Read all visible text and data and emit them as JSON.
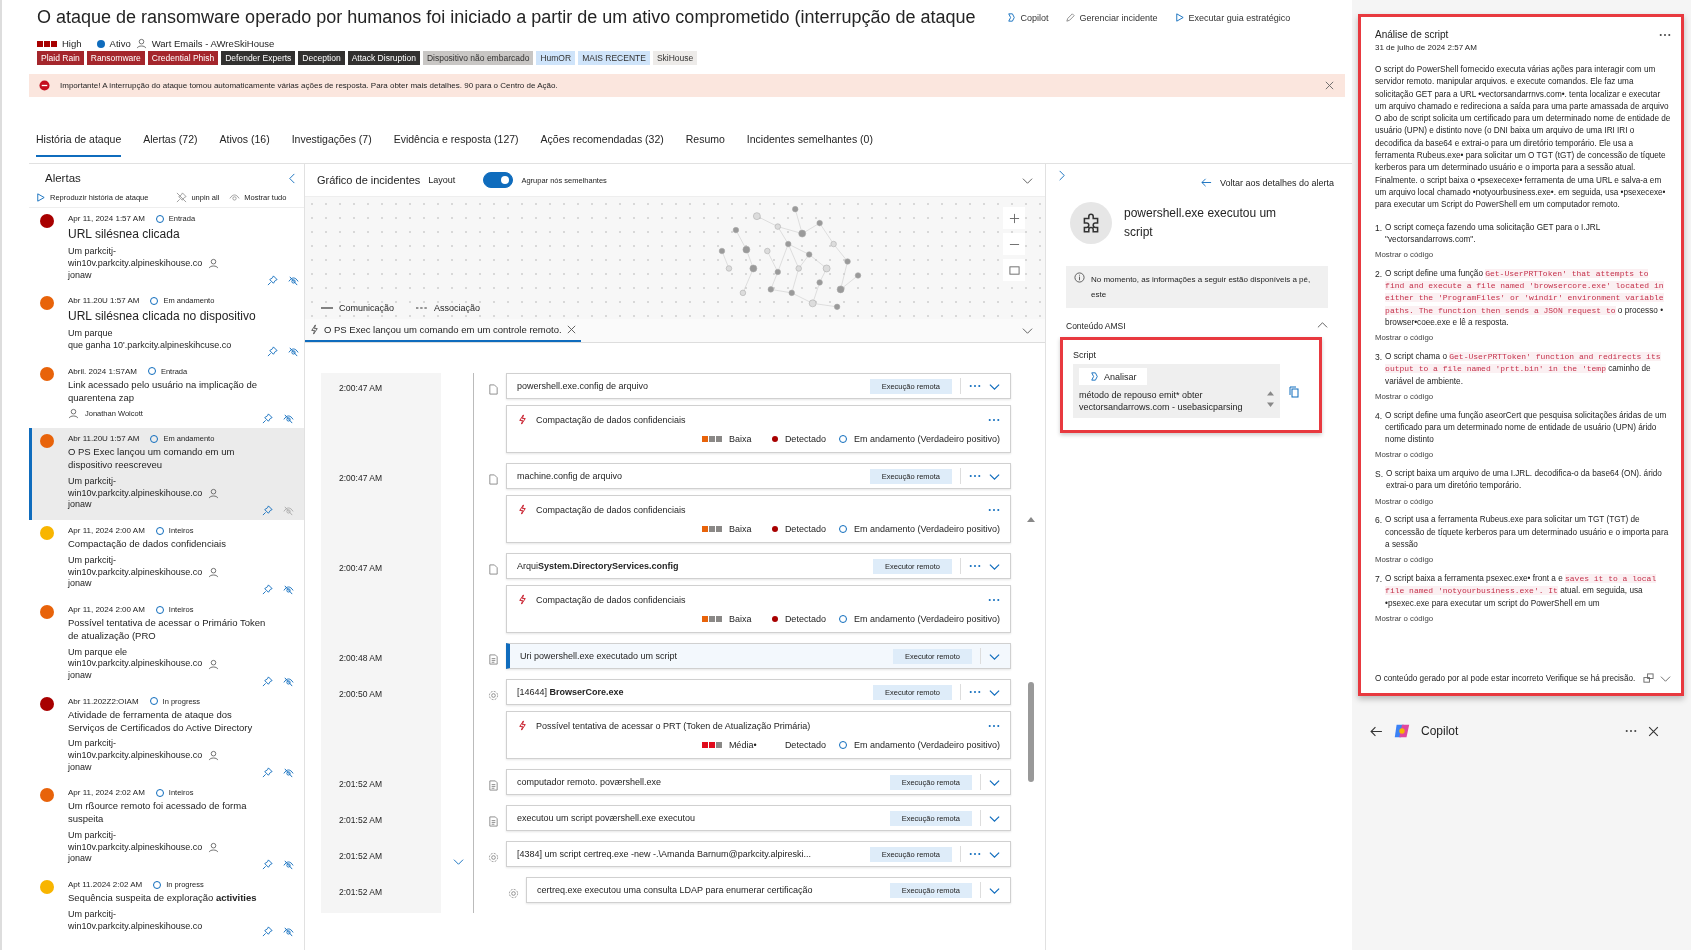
{
  "header": {
    "title": "O ataque de ransomware operado por humanos foi iniciado a partir de um ativo comprometido (interrupção de ataque",
    "actions": [
      {
        "kind": "copilot",
        "label": "Copilot"
      },
      {
        "kind": "edit",
        "label": "Gerenciar incidente"
      },
      {
        "kind": "play",
        "label": "Executar guia estratégico"
      }
    ],
    "severity": {
      "kind": "high",
      "label": "High"
    },
    "status": "Ativo",
    "owner": "Wart Emails - AWreSkiHouse",
    "tags": [
      {
        "label": "Plaid Rain",
        "color": "#a4262c"
      },
      {
        "label": "Ransomware",
        "color": "#a4262c"
      },
      {
        "label": "Credential Phish",
        "color": "#a4262c"
      },
      {
        "label": "Defender Experts",
        "color": "#323130"
      },
      {
        "label": "Deception",
        "color": "#323130"
      },
      {
        "label": "Attack Disruption",
        "color": "#323130"
      },
      {
        "label": "Dispositivo não embarcado",
        "color": "#c8c6c4"
      },
      {
        "label": "HumOR",
        "color": "#cfe4fa"
      },
      {
        "label": "MAIS RECENTE",
        "color": "#cfe4fa"
      },
      {
        "label": "SkiHouse",
        "color": "#edebe9"
      }
    ]
  },
  "banner": {
    "kind": "error",
    "text": "Importante! A interrupção do ataque tomou automaticamente várias ações de resposta. Para obter mais detalhes. 90 para o Centro de Ação."
  },
  "tabs": [
    {
      "label": "História de ataque",
      "selected": true
    },
    {
      "label": "Alertas (72)",
      "selected": false
    },
    {
      "label": "Ativos (16)",
      "selected": false
    },
    {
      "label": "Investigações (7)",
      "selected": false
    },
    {
      "label": "Evidência e resposta (127)",
      "selected": false
    },
    {
      "label": "Ações recomendadas (32)",
      "selected": false
    },
    {
      "label": "Resumo",
      "selected": false
    },
    {
      "label": "Incidentes semelhantes (0)",
      "selected": false
    }
  ],
  "alerts_panel": {
    "title": "Alertas",
    "actions": [
      {
        "kind": "play",
        "label": "Reproduzir história de ataque"
      },
      {
        "kind": "unpin",
        "label": "unpin all"
      },
      {
        "kind": "eye",
        "label": "Mostrar tudo"
      }
    ],
    "alerts": [
      {
        "color": "#a80000",
        "date": "Apr 11, 2024 1:57 AM",
        "status": "Entrada",
        "title": "URL silésnea clicada",
        "kind": "large",
        "device_lines": [
          "Um parkcitj-",
          "win10v.parkcity.alpineskihouse.co"
        ],
        "user": "jonaw",
        "selected": false
      },
      {
        "color": "#e8630a",
        "date": "Abr 11.20U 1:57 AM",
        "status": "Em andamento",
        "title": "URL silésnea clicada no dispositivo",
        "kind": "large",
        "device_lines": [
          "Um parque",
          "que  ganha  10'.parkcity.alpineskihcuse.co"
        ],
        "selected": false
      },
      {
        "color": "#e8630a",
        "date": "Abril. 2024 1:S7AM",
        "status": "Entrada",
        "title": "Link acessado pelo usuário na implicação de quarentena zap",
        "kind": "normal",
        "user": "Jonathan Wolcott",
        "selected": false
      },
      {
        "color": "#e8630a",
        "date": "Abr 11.20U 1:57 AM",
        "status": "Em andamento",
        "title": "O PS Exec lançou um comando em um dispositivo reescreveu",
        "kind": "normal",
        "device_lines": [
          "Um parkcitj-",
          "win10v.parkcity.alpineskihouse.co"
        ],
        "user": "jonaw",
        "selected": true
      },
      {
        "color": "#f8b500",
        "date": "Apr 11, 2024 2:00 AM",
        "status": "Inteiros",
        "title": "Compactação de dados confidenciais",
        "kind": "normal",
        "device_lines": [
          "Um parkcitj-",
          "win10v.parkcity.alpineskihouse.co"
        ],
        "user": "jonaw",
        "selected": false
      },
      {
        "color": "#e8630a",
        "date": "Apr 11, 2024 2:00 AM",
        "status": "Inteiros",
        "title": "Possível tentativa de acessar o Primário Token de atualização (PRO",
        "kind": "normal",
        "device_lines": [
          "Um parque ele",
          "win10v.parkcity.alpineskihouse.co"
        ],
        "user": "jonaw",
        "selected": false
      },
      {
        "color": "#a80000",
        "date": "Abr 11.202Z2:OIAM",
        "status": "In progress",
        "title": "Atividade de ferramenta de ataque dos Serviços de Certificados do Active Directory",
        "kind": "normal",
        "device_lines": [
          "Um parkcitj-",
          "win10v.parkcity.alpineskihouse.co"
        ],
        "user": "jonaw",
        "selected": false
      },
      {
        "color": "#e8630a",
        "date": "Apr 11, 2024 2:02 AM",
        "status": "Inteiros",
        "title": "Um rßource remoto foi acessado de forma suspeita",
        "kind": "normal",
        "device_lines": [
          "Um parkcitj-",
          "win10v.parkcity.alpineskihouse.co"
        ],
        "user": "jonaw",
        "selected": false
      },
      {
        "color": "#f8b500",
        "date": "Apt 11.2024 2:02 AM",
        "status": "In progress",
        "title": "Sequência suspeita de exploração **activities**",
        "kind": "normal",
        "device_lines": [
          "Um parkcitj-",
          "win10v.parkcity.alpineskihouse.co"
        ],
        "selected": false
      }
    ]
  },
  "graph": {
    "title": "Gráfico de incidentes",
    "layout_label": "Layout",
    "group_toggle": {
      "label": "Agrupar nós semelhantes",
      "on": true
    },
    "legend": [
      {
        "kind": "solid",
        "label": "Comunicação"
      },
      {
        "kind": "dashed",
        "label": "Associação"
      }
    ]
  },
  "timeline": {
    "tab": {
      "label": "O PS Exec lançou um comando em um controle remoto.",
      "selected": true
    },
    "rows": [
      {
        "time": "2:00:47 AM",
        "kind": "file",
        "text": "powershell.exe.config de arquivo",
        "tag": "Execução remota",
        "more": true,
        "selected": false,
        "alert": {
          "title": "Compactação de dados confidenciais",
          "severity": {
            "kind": "low",
            "label": "Baixa"
          },
          "detection": {
            "label": "Detectado",
            "dot": true
          },
          "state": "Em andamento (Verdadeiro positivo)"
        }
      },
      {
        "time": "2:00:47 AM",
        "kind": "file",
        "text": "machine.config de arquivo",
        "tag": "Execução remota",
        "more": true,
        "selected": false,
        "alert": {
          "title": "Compactação de dados confidenciais",
          "severity": {
            "kind": "low",
            "label": "Baixa"
          },
          "detection": {
            "label": "Detectado",
            "dot": true
          },
          "state": "Em andamento (Verdadeiro positivo)"
        }
      },
      {
        "time": "2:00:47 AM",
        "kind": "file",
        "text": "Arqui**System.DirectoryServices.config**",
        "tag": "Executor remoto",
        "more": true,
        "selected": false,
        "alert": {
          "title": "Compactação de dados confidenciais",
          "severity": {
            "kind": "low",
            "label": "Baixa"
          },
          "detection": {
            "label": "Detectado",
            "dot": true
          },
          "state": "Em andamento (Verdadeiro positivo)"
        }
      },
      {
        "time": "2:00:48 AM",
        "kind": "script",
        "text": "Uri powershell.exe executado um script",
        "tag": "Executor remoto",
        "more": false,
        "selected": true
      },
      {
        "time": "2:00:50 AM",
        "kind": "gear",
        "text": "[14644]  **BrowserCore.exe**",
        "tag": "Executor remoto",
        "more": true,
        "selected": false,
        "alert": {
          "title": "Possível tentativa de acessar o PRT (Token de Atualização Primária)",
          "severity": {
            "kind": "medium",
            "label": "Média•"
          },
          "detection": {
            "label": "Detectado",
            "dot": false
          },
          "state": "Em andamento (Verdadeiro positivo)"
        }
      },
      {
        "time": "2:01:52 AM",
        "kind": "script",
        "text": "computador remoto. poværshell.exe",
        "tag": "Execução remota",
        "more": false,
        "selected": false
      },
      {
        "time": "2:01:52 AM",
        "kind": "script",
        "text": "executou um script poværshell.exe executou",
        "tag": "Execução remota",
        "more": false,
        "selected": false
      },
      {
        "time": "2:01:52 AM",
        "kind": "gear",
        "text": "[4384]  um script certreq.exe -new -.\\Amanda Barnum@parkcity.alpireski...",
        "tag": "Execução remota",
        "more": true,
        "selected": false,
        "expanded": true,
        "children": [
          {
            "time": "2:01:52 AM",
            "kind": "gear",
            "text": "certreq.exe executou uma consulta LDAP para enumerar certificação",
            "tag": "Execução remota",
            "more": false,
            "selected": false
          }
        ]
      }
    ]
  },
  "details": {
    "back_label": "Voltar aos detalhes do alerta",
    "title": "powershell.exe executou um script",
    "info": "No momento, as informações a seguir estão disponíveis a pé, este",
    "section": {
      "label": "Conteúdo AMSI",
      "expanded": true
    },
    "script_label": "Script",
    "analyze_label": "Analisar",
    "script": "método de repouso emit* obter vectorsandarrows.com - usebasicparsing"
  },
  "copilot": {
    "title": "Copilot",
    "card": {
      "title": "Análise de script",
      "date": "31 de julho de 2024 2:57 AM",
      "summary": "O script do PowerShell fornecido executa várias ações para interagir com um servidor remoto. manipular arquivos. e execute comandos. Ele faz uma solicitação GET para a URL •vectorsandarrnvs.com•. tenta localizar e executar um arquivo chamado e redireciona a saída para uma parte amassada de arquivo O abo de script solicita um certificado para um determinado nome de entidade de usuário (UPN) e distinto nove (o DNI baixa um arquivo de uma IRI IRI o decodifica da base64 e extrai-o para um diretório temporário. Ele usa a ferramenta Rubeus.exe• para solicitar um O TGT (tGT) de concessão de tíquete kerberos para um determinado usuário e o importa para a sessão atual. Finalmente. o script baixa o •psexecexe• ferramenta de uma URL e salva-a em um arquivo local chamado •notyourbusiness.exe•. em seguida, usa •psexecexe• para executar um Script do PowerShell em um computador remoto.",
      "steps": [
        {
          "number": "1.",
          "parts": [
            {
              "kind": "text",
              "text": "O script começa fazendo uma solicitação GET para o I.JRL \"vectorsandarrows.com\"."
            }
          ],
          "link": "Mostrar o código"
        },
        {
          "number": "2.",
          "parts": [
            {
              "kind": "text",
              "text": "O script define uma função "
            },
            {
              "kind": "code",
              "text": "Get-UserPRTToken' that attempts to find and execute a file named 'browsercore.exe' located in either the 'ProgramFiles' or 'windir' environment variable paths. The function then sends a JSON request to"
            },
            {
              "kind": "text",
              "text": " o processo • browser•coee.exe e lê a resposta."
            }
          ],
          "link": "Mostrar o código"
        },
        {
          "number": "3.",
          "parts": [
            {
              "kind": "text",
              "text": "O script chama o "
            },
            {
              "kind": "code",
              "text": "Get-UserPRTToken' function and redirects its output to a file named 'prtt.bin' in the 'temp"
            },
            {
              "kind": "text",
              "text": " caminho de variável de ambiente."
            }
          ],
          "link": "Mostrar o código"
        },
        {
          "number": "4.",
          "parts": [
            {
              "kind": "text",
              "text": "O script define uma função aseorCert que pesquisa solicitações áridas de um certificado para um determinado nome de entidade de usuário (UPN) árido nome distinto"
            }
          ],
          "link": "Mostrar o código"
        },
        {
          "number": "S.",
          "parts": [
            {
              "kind": "text",
              "text": "O script baixa um arquivo de uma I.JRL. decodifica-o da base64 (ON). árido extrai-o para um diretório temporário."
            }
          ],
          "link": "Mostrar o código"
        },
        {
          "number": "6.",
          "parts": [
            {
              "kind": "text",
              "text": "O script usa a ferramenta Rubeus.exe para solicitar um TGT (TGT) de concessão de tíquete kerberos para um determinado usuário e o importa para a sessão"
            }
          ],
          "link": "Mostrar o código"
        },
        {
          "number": "7.",
          "parts": [
            {
              "kind": "text",
              "text": "O script baixa a ferramenta psexec.exe• front a e "
            },
            {
              "kind": "code",
              "text": "saves it to a local file named 'notyourbusiness.exe'. It"
            },
            {
              "kind": "text",
              "text": " atual. em seguida, usa •psexec.exe para executar um script do PowerShell em um"
            }
          ],
          "link": "Mostrar o código"
        }
      ],
      "disclaimer": "O conteúdo gerado por aI pode estar incorreto Verifique se há precisão."
    }
  }
}
